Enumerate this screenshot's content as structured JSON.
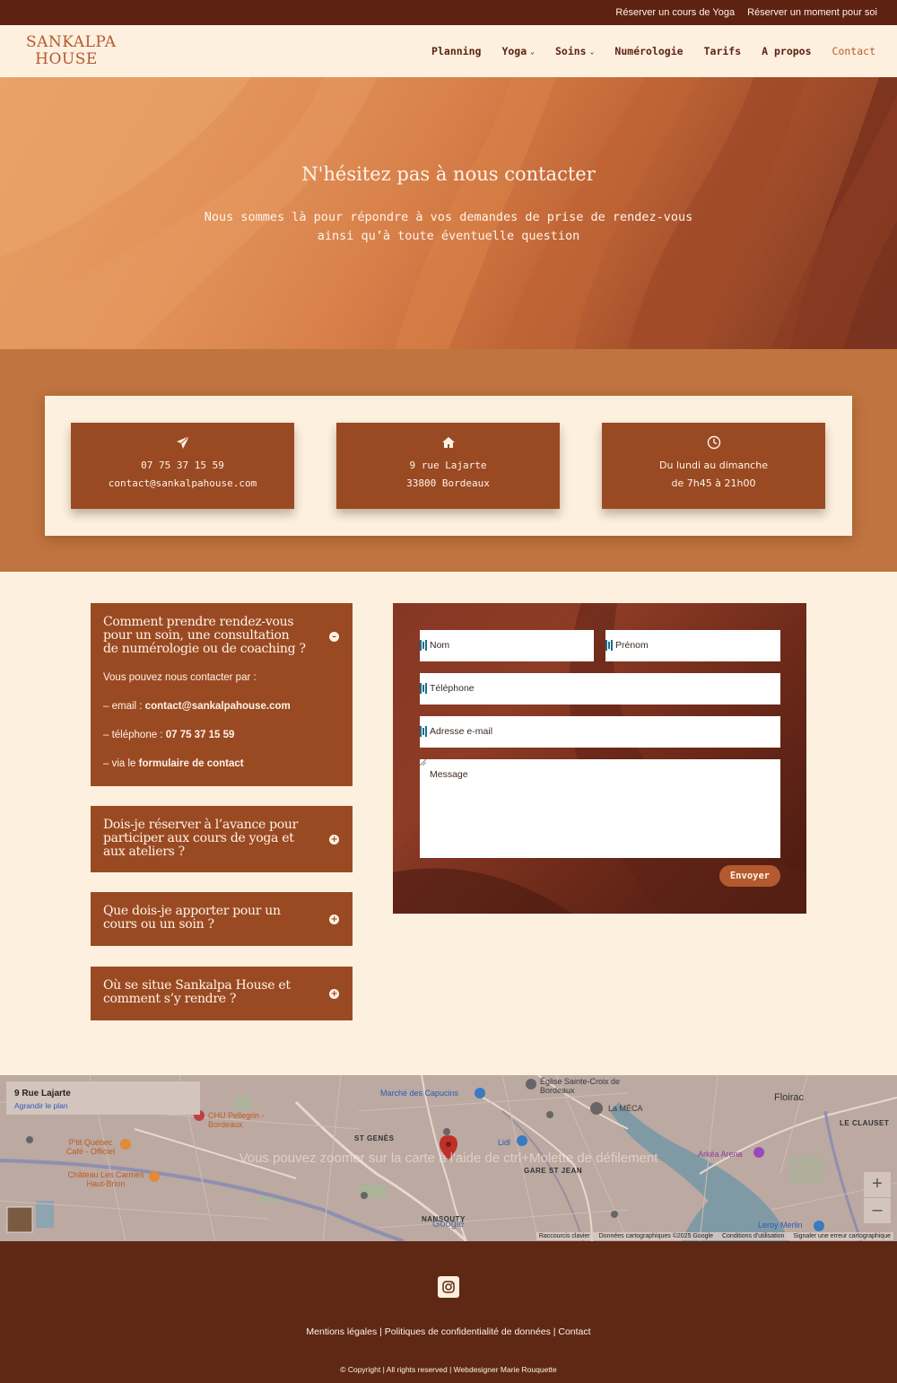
{
  "topbar": {
    "links": [
      "Réserver un cours de Yoga",
      "Réserver un moment pour soi"
    ]
  },
  "header": {
    "logo_line1": "SANKALPA",
    "logo_line2": "HOUSE",
    "nav": [
      {
        "label": "Planning"
      },
      {
        "label": "Yoga",
        "dropdown": true
      },
      {
        "label": "Soins",
        "dropdown": true
      },
      {
        "label": "Numérologie"
      },
      {
        "label": "Tarifs"
      },
      {
        "label": "A propos"
      },
      {
        "label": "Contact",
        "active": true
      }
    ]
  },
  "hero": {
    "title": "N'hésitez pas à nous contacter",
    "subtitle_line1": "Nous sommes là pour répondre à vos demandes de prise de rendez-vous",
    "subtitle_line2": "ainsi qu’à toute éventuelle question"
  },
  "contact_cards": {
    "phone": {
      "icon": "paper-plane-icon",
      "line1": "07 75 37 15 59",
      "line2": "contact@sankalpahouse.com"
    },
    "address": {
      "icon": "home-icon",
      "line1": "9 rue Lajarte",
      "line2": "33800 Bordeaux"
    },
    "hours": {
      "icon": "clock-icon",
      "line1": "Du lundi au dimanche",
      "line2": "de 7h45 à 21h00"
    }
  },
  "faq": {
    "items": [
      {
        "question": "Comment prendre rendez-vous pour un soin, une consultation de numérologie ou de coaching ?",
        "open": true,
        "answer_intro": "Vous pouvez nous contacter par :",
        "email_prefix": "– email : ",
        "email": "contact@sankalpahouse.com",
        "phone_prefix": "– téléphone : ",
        "phone": "07 75  37 15 59",
        "form_prefix": "– via le ",
        "form_link": "formulaire de contact"
      },
      {
        "question": "Dois-je réserver à l’avance pour participer aux cours de yoga et aux ateliers ?",
        "open": false
      },
      {
        "question": "Que dois-je apporter pour un cours ou un soin ?",
        "open": false
      },
      {
        "question": "Où se situe Sankalpa House et comment s’y rendre ?",
        "open": false
      }
    ]
  },
  "form": {
    "nom": "Nom",
    "prenom": "Prénom",
    "telephone": "Téléphone",
    "email": "Adresse e-mail",
    "message": "Message",
    "submit": "Envoyer"
  },
  "map": {
    "place_title": "9 Rue Lajarte",
    "enlarge": "Agrandir le plan",
    "overlay": "Vous pouvez zoomer sur la carte à l'aide de ctrl+Molette de défilement",
    "footer": [
      "Raccourcis clavier",
      "Données cartographiques ©2025 Google",
      "Conditions d'utilisation",
      "Signaler une erreur cartographique"
    ],
    "labels": {
      "eglise": "Église Sainte-Croix de Bordeaux",
      "marche": "Marché des Capucins",
      "meca": "La MÉCA",
      "floirac": "Floirac",
      "clauset": "LE CLAUSET",
      "chu": "CHU Pellegrin - Bordeaux",
      "ptit": "P'tit Québec Café - Officiel",
      "chateau": "Château Les Carmes Haut-Brion",
      "st_genes": "ST GENÈS",
      "lidl": "Lidl",
      "gare": "GARE ST JEAN",
      "arkea": "Arkéa Arena",
      "nansouty": "NANSOUTY",
      "leroy": "Leroy Merlin",
      "google": "Google"
    }
  },
  "footer": {
    "links": "Mentions légales | Politiques de confidentialité de données | Contact",
    "copyright": "©  Copyright | All rights reserved | Webdesigner Marie Rouquette"
  },
  "colors": {
    "brand_dark": "#5e2212",
    "brand_rust": "#9a4a23",
    "accent": "#b35a2e",
    "cream": "#fdf0df"
  }
}
